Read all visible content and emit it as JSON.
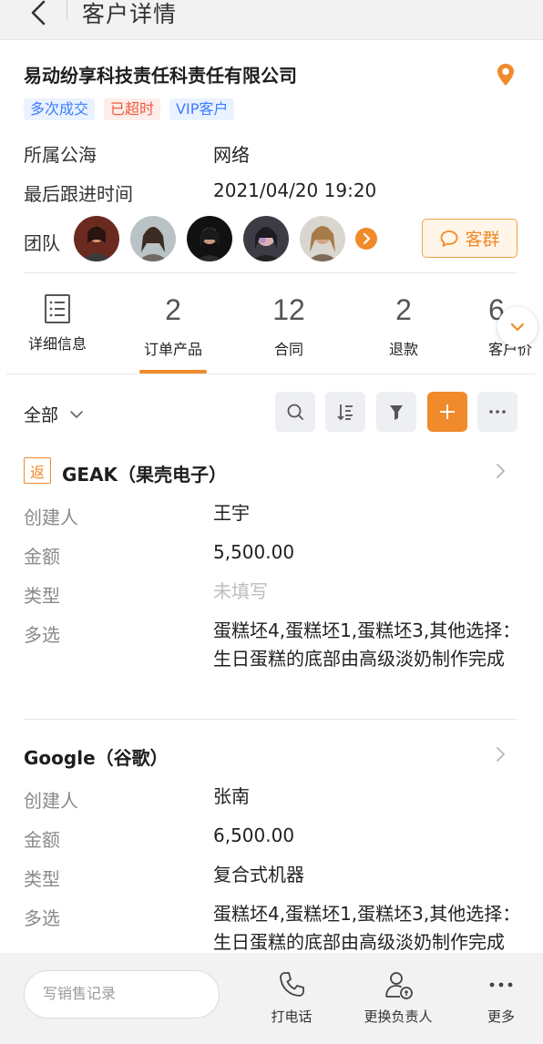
{
  "header": {
    "title": "客户详情"
  },
  "customer": {
    "name": "易动纷享科技责任科责任有限公司",
    "tags": [
      "多次成交",
      "已超时",
      "VIP客户"
    ],
    "fields": [
      {
        "label": "所属公海",
        "value": "网络"
      },
      {
        "label": "最后跟进时间",
        "value": "2021/04/20 19:20"
      }
    ],
    "team_label": "团队",
    "group_button": "客群"
  },
  "tabs": [
    {
      "label": "详细信息",
      "count": ""
    },
    {
      "label": "订单产品",
      "count": "2"
    },
    {
      "label": "合同",
      "count": "12"
    },
    {
      "label": "退款",
      "count": "2"
    },
    {
      "label": "客户价",
      "count": "6"
    }
  ],
  "filter": {
    "label": "全部"
  },
  "records": [
    {
      "badge": "返",
      "title": "GEAK（果壳电子）",
      "fields": [
        {
          "label": "创建人",
          "value": "王宇"
        },
        {
          "label": "金额",
          "value": "5,500.00"
        },
        {
          "label": "类型",
          "value": "未填写"
        },
        {
          "label": "多选",
          "value": "蛋糕坯4,蛋糕坯1,蛋糕坯3,其他选择：生日蛋糕的底部由高级淡奶制作完成"
        }
      ]
    },
    {
      "title": "Google（谷歌）",
      "fields": [
        {
          "label": "创建人",
          "value": "张南"
        },
        {
          "label": "金额",
          "value": "6,500.00"
        },
        {
          "label": "类型",
          "value": "复合式机器"
        },
        {
          "label": "多选",
          "value": "蛋糕坯4,蛋糕坯1,蛋糕坯3,其他选择：生日蛋糕的底部由高级淡奶制作完成"
        }
      ]
    }
  ],
  "bottom": {
    "input_placeholder": "写销售记录",
    "actions": [
      "打电话",
      "更换负责人",
      "更多"
    ]
  },
  "colors": {
    "accent": "#f08a2a",
    "tag_blue": "#3b7cff",
    "tag_red": "#f05a3d"
  }
}
